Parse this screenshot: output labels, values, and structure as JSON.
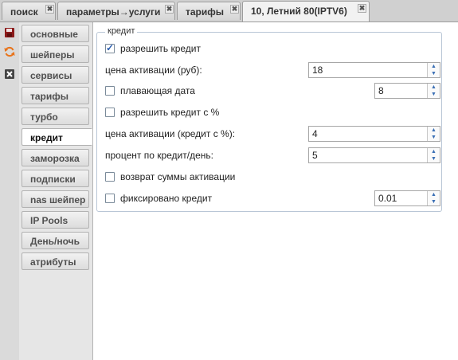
{
  "tabs": [
    {
      "label": "поиск"
    },
    {
      "label": "параметры→услуги"
    },
    {
      "label": "тарифы"
    },
    {
      "label": "10, Летний 80(IPTV6)"
    }
  ],
  "tab_close_glyph": "✖",
  "toolbar": {
    "icons": [
      "save-icon",
      "refresh-icon",
      "close-icon"
    ]
  },
  "sidenav": {
    "items": [
      {
        "label": "основные"
      },
      {
        "label": "шейперы"
      },
      {
        "label": "сервисы"
      },
      {
        "label": "тарифы"
      },
      {
        "label": "турбо"
      },
      {
        "label": "кредит"
      },
      {
        "label": "заморозка"
      },
      {
        "label": "подписки"
      },
      {
        "label": "nas шейпер"
      },
      {
        "label": "IP Pools"
      },
      {
        "label": "День/ночь"
      },
      {
        "label": "атрибуты"
      }
    ],
    "active": "кредит"
  },
  "credit": {
    "legend": "кредит",
    "allow_credit": {
      "label": "разрешить кредит",
      "checked": true
    },
    "activation_price": {
      "label": "цена активации (руб):",
      "value": "18"
    },
    "floating_date": {
      "label": "плавающая дата",
      "checked": false,
      "value": "8"
    },
    "allow_percent_credit": {
      "label": "разрешить кредит с %",
      "checked": false
    },
    "activation_price_percent": {
      "label": "цена активации (кредит с %):",
      "value": "4"
    },
    "percent_per_day": {
      "label": "процент по кредит/день:",
      "value": "5"
    },
    "return_activation": {
      "label": "возврат суммы активации",
      "checked": false
    },
    "fixed_credit": {
      "label": "фиксировано кредит",
      "checked": false,
      "value": "0.01"
    }
  },
  "colors": {
    "accent": "#3a6fb5",
    "save_icon": "#8b1a1a",
    "refresh_icon": "#e8731a",
    "close_icon": "#444444"
  }
}
